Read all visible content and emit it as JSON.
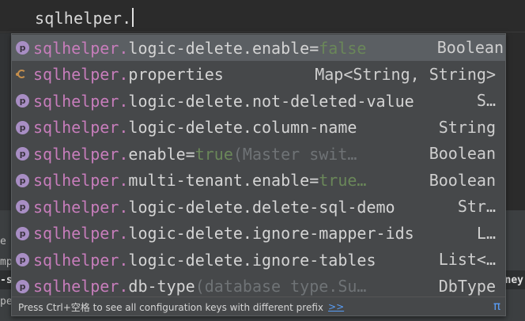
{
  "editor": {
    "line_text": "sqlhelper."
  },
  "bottom_edge": {
    "left_1": "e j",
    "left_2": "mp",
    "left_3": "-sp",
    "left_4": "pe",
    "right_1": "ney"
  },
  "completion": {
    "items": [
      {
        "prefix": "sqlhelper.",
        "name": "logic-delete.enable",
        "eq": "=",
        "default": "false",
        "desc": "",
        "type": "Boolean",
        "icon": "property-icon",
        "selected": true
      },
      {
        "prefix": "sqlhelper.",
        "name": "properties",
        "eq": "",
        "default": "",
        "desc": "",
        "type": "Map<String, String>",
        "icon": "map-icon",
        "selected": false
      },
      {
        "prefix": "sqlhelper.",
        "name": "logic-delete.not-deleted-value",
        "eq": "",
        "default": "",
        "desc": "",
        "type": "S…",
        "icon": "property-icon",
        "selected": false
      },
      {
        "prefix": "sqlhelper.",
        "name": "logic-delete.column-name",
        "eq": "",
        "default": "",
        "desc": "",
        "type": "String",
        "icon": "property-icon",
        "selected": false
      },
      {
        "prefix": "sqlhelper.",
        "name": "enable",
        "eq": "=",
        "default": "true",
        "desc": " (Master swit…",
        "type": "Boolean",
        "icon": "property-icon",
        "selected": false
      },
      {
        "prefix": "sqlhelper.",
        "name": "multi-tenant.enable",
        "eq": "=",
        "default": "true…",
        "desc": "",
        "type": "Boolean",
        "icon": "property-icon",
        "selected": false
      },
      {
        "prefix": "sqlhelper.",
        "name": "logic-delete.delete-sql-demo",
        "eq": "",
        "default": "",
        "desc": "",
        "type": "Str…",
        "icon": "property-icon",
        "selected": false
      },
      {
        "prefix": "sqlhelper.",
        "name": "logic-delete.ignore-mapper-ids",
        "eq": "",
        "default": "",
        "desc": "",
        "type": "L…",
        "icon": "property-icon",
        "selected": false
      },
      {
        "prefix": "sqlhelper.",
        "name": "logic-delete.ignore-tables",
        "eq": "",
        "default": "",
        "desc": "",
        "type": "List<…",
        "icon": "property-icon",
        "selected": false
      },
      {
        "prefix": "sqlhelper.",
        "name": "db-type",
        "eq": "",
        "default": "",
        "desc": " (database type.Su…",
        "type": "DbType",
        "icon": "property-icon",
        "selected": false
      }
    ],
    "badge_letter": "p",
    "footer": {
      "hint": "Press Ctrl+空格 to see all configuration keys with different prefix",
      "more": ">>",
      "pi": "π"
    }
  },
  "colors": {
    "prefix": "#c77dbb",
    "default_value": "#6a8759",
    "description": "#6f7376",
    "link": "#589df6",
    "selection": "#5b5f63"
  }
}
